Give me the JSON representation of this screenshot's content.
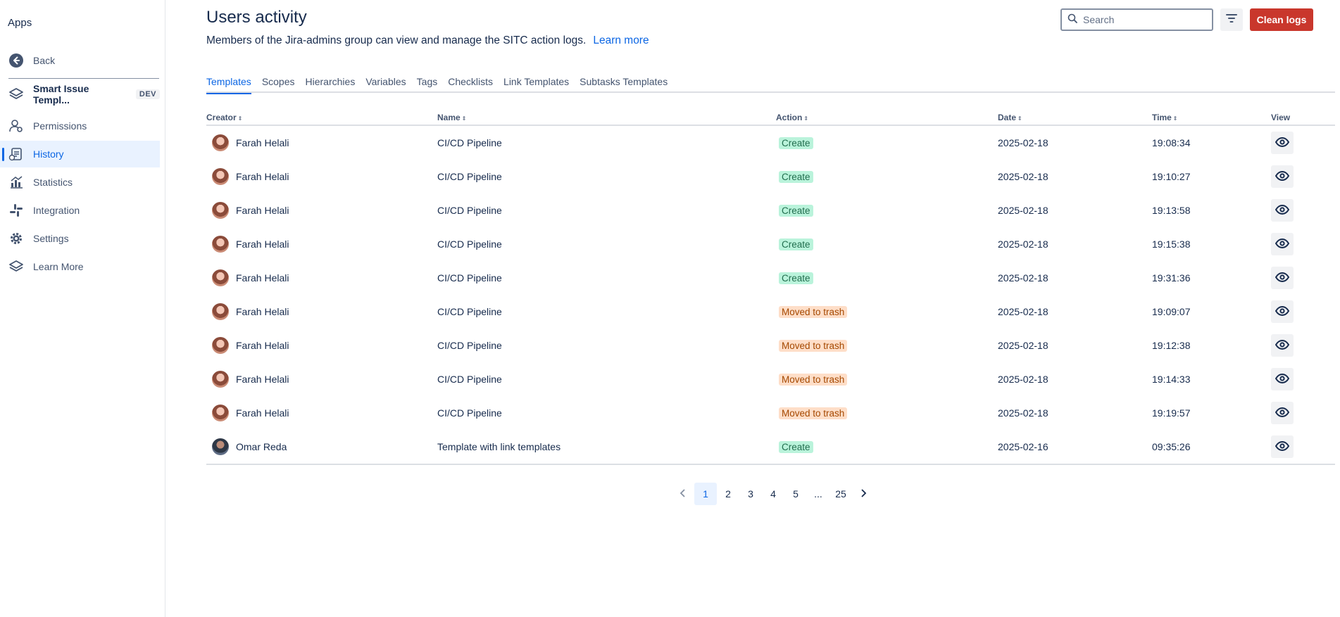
{
  "sidebar": {
    "title": "Apps",
    "back_label": "Back",
    "app_name": "Smart Issue Templ...",
    "app_badge": "DEV",
    "items": [
      {
        "label": "Permissions",
        "icon": "permissions-icon"
      },
      {
        "label": "History",
        "icon": "history-icon",
        "active": true
      },
      {
        "label": "Statistics",
        "icon": "statistics-icon"
      },
      {
        "label": "Integration",
        "icon": "integration-icon"
      },
      {
        "label": "Settings",
        "icon": "gear-icon"
      },
      {
        "label": "Learn More",
        "icon": "learn-more-icon"
      }
    ]
  },
  "header": {
    "title": "Users activity",
    "subtitle": "Members of the Jira-admins group can view and manage the SITC action logs.",
    "learn_more": "Learn more",
    "search_placeholder": "Search",
    "clean_logs_label": "Clean logs"
  },
  "tabs": [
    "Templates",
    "Scopes",
    "Hierarchies",
    "Variables",
    "Tags",
    "Checklists",
    "Link Templates",
    "Subtasks Templates"
  ],
  "active_tab": "Templates",
  "table": {
    "columns": [
      "Creator",
      "Name",
      "Action",
      "Date",
      "Time",
      "View"
    ],
    "rows": [
      {
        "creator": "Farah Helali",
        "avatar": "f",
        "name": "CI/CD Pipeline",
        "action": "Create",
        "date": "2025-02-18",
        "time": "19:08:34"
      },
      {
        "creator": "Farah Helali",
        "avatar": "f",
        "name": "CI/CD Pipeline",
        "action": "Create",
        "date": "2025-02-18",
        "time": "19:10:27"
      },
      {
        "creator": "Farah Helali",
        "avatar": "f",
        "name": "CI/CD Pipeline",
        "action": "Create",
        "date": "2025-02-18",
        "time": "19:13:58"
      },
      {
        "creator": "Farah Helali",
        "avatar": "f",
        "name": "CI/CD Pipeline",
        "action": "Create",
        "date": "2025-02-18",
        "time": "19:15:38"
      },
      {
        "creator": "Farah Helali",
        "avatar": "f",
        "name": "CI/CD Pipeline",
        "action": "Create",
        "date": "2025-02-18",
        "time": "19:31:36"
      },
      {
        "creator": "Farah Helali",
        "avatar": "f",
        "name": "CI/CD Pipeline",
        "action": "Moved to trash",
        "date": "2025-02-18",
        "time": "19:09:07"
      },
      {
        "creator": "Farah Helali",
        "avatar": "f",
        "name": "CI/CD Pipeline",
        "action": "Moved to trash",
        "date": "2025-02-18",
        "time": "19:12:38"
      },
      {
        "creator": "Farah Helali",
        "avatar": "f",
        "name": "CI/CD Pipeline",
        "action": "Moved to trash",
        "date": "2025-02-18",
        "time": "19:14:33"
      },
      {
        "creator": "Farah Helali",
        "avatar": "f",
        "name": "CI/CD Pipeline",
        "action": "Moved to trash",
        "date": "2025-02-18",
        "time": "19:19:57"
      },
      {
        "creator": "Omar Reda",
        "avatar": "m",
        "name": "Template with link templates",
        "action": "Create",
        "date": "2025-02-16",
        "time": "09:35:26"
      }
    ]
  },
  "pagination": {
    "pages": [
      "1",
      "2",
      "3",
      "4",
      "5",
      "...",
      "25"
    ],
    "current": "1"
  },
  "colors": {
    "accent": "#0c66e4",
    "danger_button": "#c9372c",
    "create_lozenge": "#baf3db",
    "trash_lozenge": "#fedec8"
  }
}
